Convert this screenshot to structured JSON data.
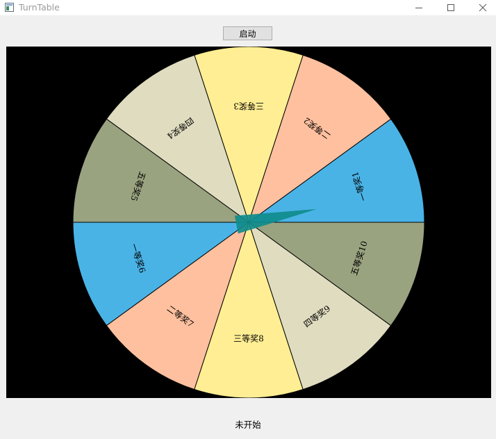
{
  "window": {
    "title": "TurnTable",
    "controls": {
      "minimize_icon": "minimize-icon",
      "maximize_icon": "maximize-icon",
      "close_icon": "close-icon"
    }
  },
  "toolbar": {
    "start_label": "启动"
  },
  "wheel": {
    "segments": [
      {
        "label": "一等奖1",
        "color": "#4ab3e6"
      },
      {
        "label": "二等奖2",
        "color": "#ffc09f"
      },
      {
        "label": "三等奖3",
        "color": "#ffee93"
      },
      {
        "label": "四等奖4",
        "color": "#e0dcbf"
      },
      {
        "label": "五等奖5",
        "color": "#9aa380"
      },
      {
        "label": "一等奖6",
        "color": "#4ab3e6"
      },
      {
        "label": "二等奖7",
        "color": "#ffc09f"
      },
      {
        "label": "三等奖8",
        "color": "#ffee93"
      },
      {
        "label": "四等奖9",
        "color": "#e0dcbf"
      },
      {
        "label": "五等奖10",
        "color": "#9aa380"
      }
    ],
    "pointer_color": "#0f8c8c",
    "pointer_angle_deg": -11
  },
  "status": {
    "text": "未开始"
  }
}
